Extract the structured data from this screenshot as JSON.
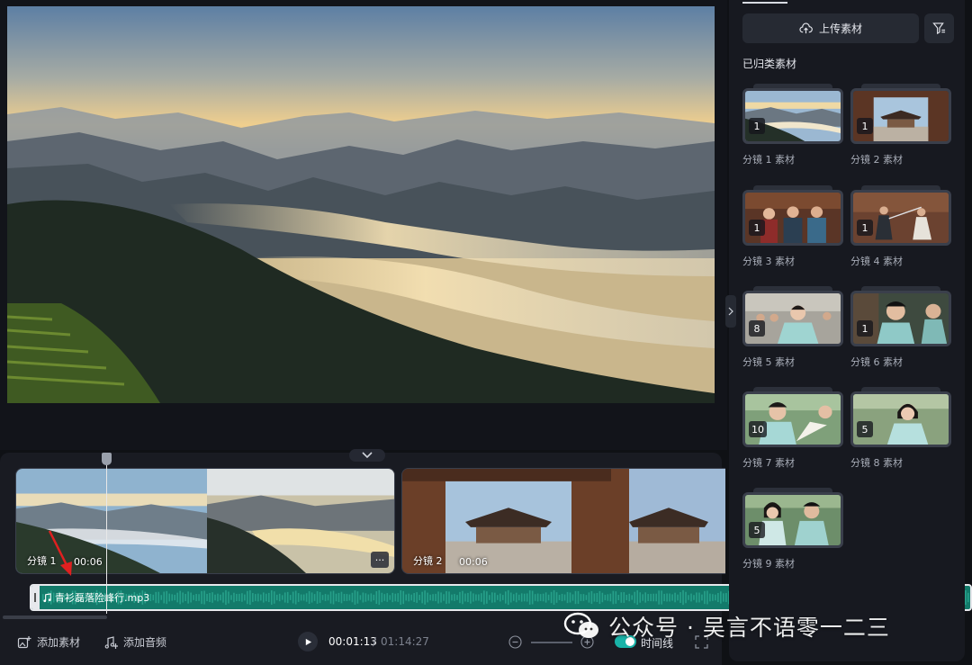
{
  "side_panel": {
    "upload_label": "上传素材",
    "section_title": "已归类素材",
    "assets": [
      {
        "label": "分镜 1 素材",
        "count": "1",
        "scene": "mountains"
      },
      {
        "label": "分镜 2 素材",
        "count": "1",
        "scene": "palace-gate"
      },
      {
        "label": "分镜 3 素材",
        "count": "1",
        "scene": "hall-people"
      },
      {
        "label": "分镜 4 素材",
        "count": "1",
        "scene": "sword-fight"
      },
      {
        "label": "分镜 5 素材",
        "count": "8",
        "scene": "crowd-portrait"
      },
      {
        "label": "分镜 6 素材",
        "count": "1",
        "scene": "portrait-pair"
      },
      {
        "label": "分镜 7 素材",
        "count": "10",
        "scene": "fan-portrait"
      },
      {
        "label": "分镜 8 素材",
        "count": "5",
        "scene": "lady-portrait"
      },
      {
        "label": "分镜 9 素材",
        "count": "5",
        "scene": "couple-portrait"
      }
    ]
  },
  "timeline": {
    "clips": [
      {
        "name": "分镜 1",
        "duration": "00:06",
        "more": "···"
      },
      {
        "name": "分镜 2",
        "duration": "00:06"
      }
    ],
    "audio": {
      "filename": "青衫磊落险峰行.mp3"
    }
  },
  "toolbar": {
    "add_asset": "添加素材",
    "add_audio": "添加音频",
    "current_time": "00:01:13",
    "separator": "/",
    "total_time": "01:14:27",
    "timeline_toggle_label": "时间线",
    "timeline_toggle_on": true
  },
  "watermark": {
    "text": "公众号 · 吴言不语零一二三"
  },
  "colors": {
    "accent": "#19b3a8",
    "audio_track": "#137a6a",
    "panel_bg": "#171920",
    "annotation_arrow": "#e02020"
  }
}
